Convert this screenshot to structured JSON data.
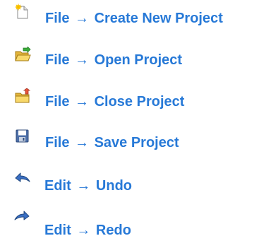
{
  "menu_items": [
    {
      "menu": "File",
      "action": "Create New Project",
      "icon": "new-document-icon"
    },
    {
      "menu": "File",
      "action": "Open Project",
      "icon": "open-folder-icon"
    },
    {
      "menu": "File",
      "action": "Close Project",
      "icon": "close-folder-icon"
    },
    {
      "menu": "File",
      "action": "Save Project",
      "icon": "floppy-disk-icon"
    },
    {
      "menu": "Edit",
      "action": "Undo",
      "icon": "undo-arrow-icon"
    },
    {
      "menu": "Edit",
      "action": "Redo",
      "icon": "redo-arrow-icon"
    }
  ],
  "arrow_symbol": "→",
  "colors": {
    "text": "#2779d7"
  }
}
